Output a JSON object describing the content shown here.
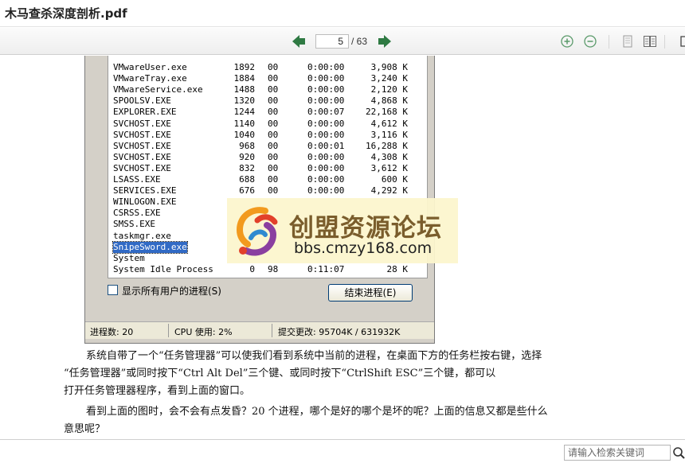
{
  "window": {
    "title": "木马查杀深度剖析.pdf"
  },
  "toolbar": {
    "page_current": "5",
    "page_total": "/ 63"
  },
  "task_manager": {
    "processes": [
      {
        "name": "VMwareUser.exe",
        "pid": "1892",
        "cpu": "00",
        "time": "0:00:00",
        "mem": "3,908 K",
        "selected": false
      },
      {
        "name": "VMwareTray.exe",
        "pid": "1884",
        "cpu": "00",
        "time": "0:00:00",
        "mem": "3,240 K",
        "selected": false
      },
      {
        "name": "VMwareService.exe",
        "pid": "1488",
        "cpu": "00",
        "time": "0:00:00",
        "mem": "2,120 K",
        "selected": false
      },
      {
        "name": "SPOOLSV.EXE",
        "pid": "1320",
        "cpu": "00",
        "time": "0:00:00",
        "mem": "4,868 K",
        "selected": false
      },
      {
        "name": "EXPLORER.EXE",
        "pid": "1244",
        "cpu": "00",
        "time": "0:00:07",
        "mem": "22,168 K",
        "selected": false
      },
      {
        "name": "SVCHOST.EXE",
        "pid": "1140",
        "cpu": "00",
        "time": "0:00:00",
        "mem": "4,612 K",
        "selected": false
      },
      {
        "name": "SVCHOST.EXE",
        "pid": "1040",
        "cpu": "00",
        "time": "0:00:00",
        "mem": "3,116 K",
        "selected": false
      },
      {
        "name": "SVCHOST.EXE",
        "pid": "968",
        "cpu": "00",
        "time": "0:00:01",
        "mem": "16,288 K",
        "selected": false
      },
      {
        "name": "SVCHOST.EXE",
        "pid": "920",
        "cpu": "00",
        "time": "0:00:00",
        "mem": "4,308 K",
        "selected": false
      },
      {
        "name": "SVCHOST.EXE",
        "pid": "832",
        "cpu": "00",
        "time": "0:00:00",
        "mem": "3,612 K",
        "selected": false
      },
      {
        "name": "LSASS.EXE",
        "pid": "688",
        "cpu": "00",
        "time": "0:00:00",
        "mem": "600 K",
        "selected": false
      },
      {
        "name": "SERVICES.EXE",
        "pid": "676",
        "cpu": "00",
        "time": "0:00:00",
        "mem": "4,292 K",
        "selected": false
      },
      {
        "name": "WINLOGON.EXE",
        "pid": "",
        "cpu": "",
        "time": "",
        "mem": "",
        "selected": false
      },
      {
        "name": "CSRSS.EXE",
        "pid": "",
        "cpu": "",
        "time": "",
        "mem": "",
        "selected": false
      },
      {
        "name": "SMSS.EXE",
        "pid": "",
        "cpu": "",
        "time": "",
        "mem": "",
        "selected": false
      },
      {
        "name": "taskmgr.exe",
        "pid": "",
        "cpu": "",
        "time": "",
        "mem": "",
        "selected": false
      },
      {
        "name": "SnipeSword.exe",
        "pid": "",
        "cpu": "",
        "time": "",
        "mem": "",
        "selected": true
      },
      {
        "name": "System",
        "pid": "",
        "cpu": "",
        "time": "",
        "mem": "",
        "selected": false
      },
      {
        "name": "System Idle Process",
        "pid": "0",
        "cpu": "98",
        "time": "0:11:07",
        "mem": "28 K",
        "selected": false
      }
    ],
    "show_all_label": "显示所有用户的进程(S)",
    "end_process_label": "结束进程(E)",
    "status_processes": "进程数: 20",
    "status_cpu": "CPU 使用: 2%",
    "status_commit": "提交更改: 95704K / 631932K"
  },
  "watermark": {
    "name": "创盟资源论坛",
    "url": "bbs.cmzy168.com"
  },
  "body_text": {
    "p1_line1": "系统自带了一个“任务管理器”可以使我们看到系统中当前的进程，在桌面下方的任务栏按右键，选择",
    "p1_line2": "“任务管理器”或同时按下“Ctrl  Alt  Del”三个键、或同时按下“CtrlShift  ESC”三个键，都可以",
    "p1_line3": "打开任务管理器程序，看到上面的窗口。",
    "p2_line1": "看到上面的图时，会不会有点发昏？20 个进程，哪个是好的哪个是坏的呢？上面的信息又都是些什么",
    "p2_line2": "意思呢？"
  },
  "search": {
    "placeholder": "请输入检索关键词"
  },
  "icons": {
    "prev": "arrow-left-icon",
    "next": "arrow-right-icon",
    "zoom_in": "zoom-in-icon",
    "zoom_out": "zoom-out-icon",
    "single_page": "single-page-icon",
    "two_page": "two-page-icon",
    "fit": "fit-window-icon",
    "search": "search-icon"
  },
  "colors": {
    "nav_arrow": "#2f7a43",
    "zoom_icon": "#5a9a6a",
    "selection": "#316ac5",
    "watermark_bg": "#fcf5cd",
    "watermark_text": "#7a5d2c"
  }
}
